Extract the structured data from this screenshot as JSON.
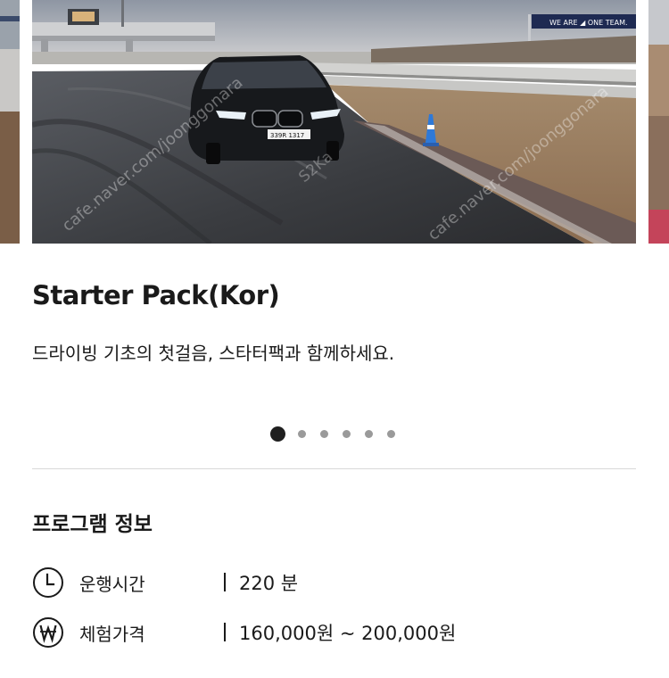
{
  "carousel": {
    "slide_image": "track-car-photo",
    "plate": "339R 1317",
    "banner_text": "WE ARE ◢ ONE TEAM.",
    "watermark": "cafe.naver.com/joonggonara",
    "watermark_tag": "S2Ka",
    "active_index": 1,
    "slide_count": 6
  },
  "program": {
    "title": "Starter Pack(Kor)",
    "subtitle": "드라이빙 기초의 첫걸음, 스타터팩과 함께하세요."
  },
  "info": {
    "section_title": "프로그램 정보",
    "rows": [
      {
        "icon": "clock-icon",
        "label": "운행시간",
        "value": "220 분"
      },
      {
        "icon": "won-icon",
        "label": "체험가격",
        "value": "160,000원 ~ 200,000원"
      }
    ]
  },
  "colors": {
    "text": "#1a1a1a",
    "dot_active": "#1f1f1f",
    "dot_inactive": "#9a9a9a",
    "divider": "#d9d9d9"
  }
}
